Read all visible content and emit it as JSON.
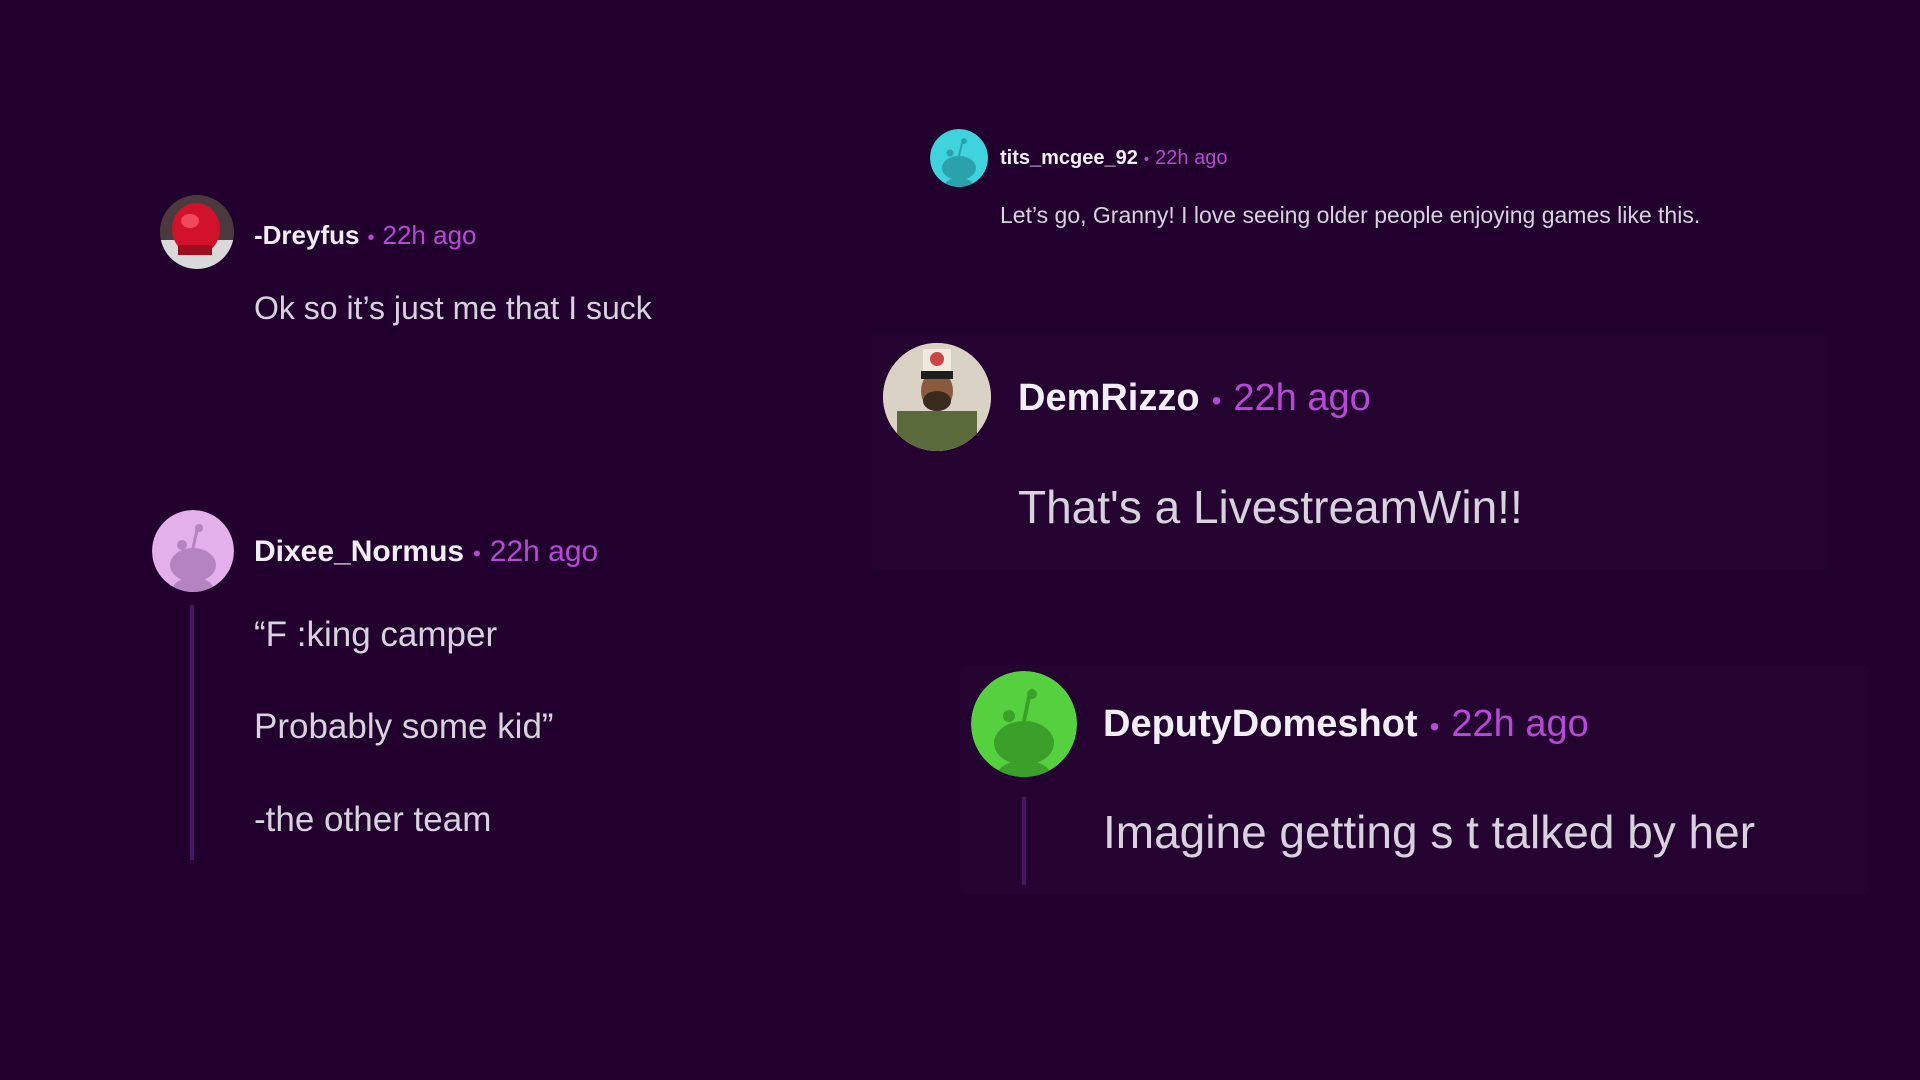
{
  "comments": [
    {
      "username": "-Dreyfus",
      "separator": "•",
      "time": "22h ago",
      "avatar_icon": "red-helmet-avatar-icon",
      "lines": [
        "Ok so it’s just me that I suck"
      ]
    },
    {
      "username": "Dixee_Normus",
      "separator": "•",
      "time": "22h ago",
      "avatar_icon": "snoo-avatar-icon",
      "avatar_color": "#e3b0ec",
      "lines": [
        "“F  :king camper",
        "Probably some kid”",
        "-the other team"
      ]
    },
    {
      "username": "tits_mcgee_92",
      "separator": "•",
      "time": "22h ago",
      "avatar_icon": "snoo-avatar-icon",
      "avatar_color": "#3fd3de",
      "lines": [
        "Let’s go, Granny! I love seeing older people enjoying games like this."
      ]
    },
    {
      "username": "DemRizzo",
      "separator": "•",
      "time": "22h ago",
      "avatar_icon": "person-photo-avatar-icon",
      "lines": [
        "That's a LivestreamWin!!"
      ]
    },
    {
      "username": "DeputyDomeshot",
      "separator": "•",
      "time": "22h ago",
      "avatar_icon": "snoo-avatar-icon",
      "avatar_color": "#55d13f",
      "lines": [
        "Imagine getting s    t talked by her"
      ]
    }
  ],
  "colors": {
    "background": "#22002e",
    "username": "#f2eef7",
    "timestamp": "#b64ad6",
    "body_text": "#d8d2df",
    "thread_line": "#4c1266"
  }
}
